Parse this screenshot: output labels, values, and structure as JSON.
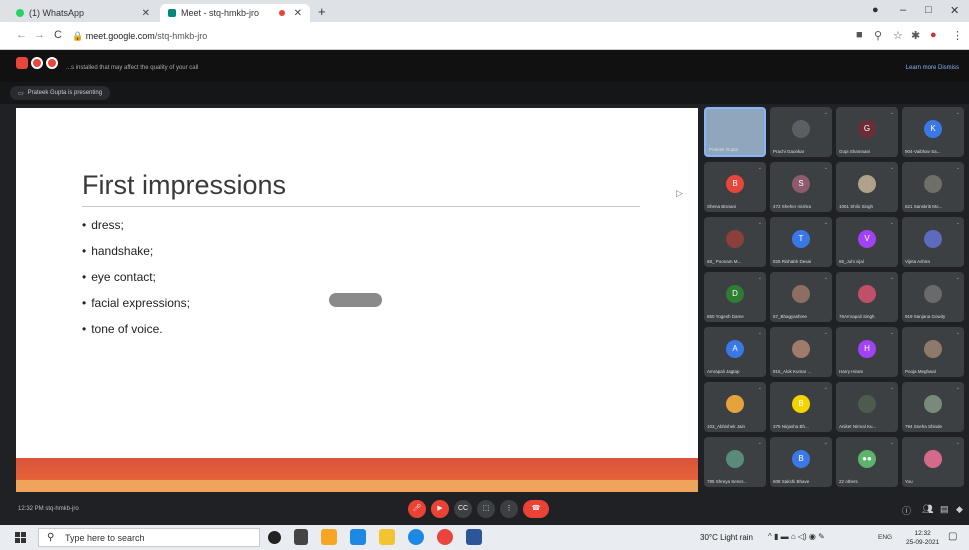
{
  "browser": {
    "tabs": [
      {
        "title": "(1) WhatsApp",
        "close": "✕"
      },
      {
        "title": "Meet - stq-hmkb-jro",
        "close": "✕"
      }
    ],
    "new_tab": "+",
    "url_host": "meet.google.com",
    "url_path": "/stq-hmkb-jro"
  },
  "meet": {
    "warning": "...s installed that may affect the quality of your call",
    "warning_actions": "Learn more   Dismiss",
    "presenting": "Prateek Gupta is presenting",
    "meeting_info": "12:32 PM   stq-hmkb-jro"
  },
  "slide": {
    "title": "First impressions",
    "bullets": [
      "dress;",
      "handshake;",
      "eye contact;",
      "facial expressions;",
      "tone of voice."
    ]
  },
  "participants": [
    {
      "name": "Prateek Gupta",
      "initial": "",
      "color": "#8fa7bd",
      "self": true
    },
    {
      "name": "Prachi Gaonkar",
      "initial": "",
      "color": "#5b5e63"
    },
    {
      "name": "Gopi Shamnani",
      "initial": "G",
      "color": "#6b2e39"
    },
    {
      "name": "904-Vaibhav Sa...",
      "initial": "K",
      "color": "#3b78e7"
    },
    {
      "name": "Shena Bisnani",
      "initial": "B",
      "color": "#e8453c"
    },
    {
      "name": "472 Sheher mishra",
      "initial": "S",
      "color": "#8d5a6e"
    },
    {
      "name": "1061 Shilo Singh",
      "initial": "",
      "color": "#b0a18a"
    },
    {
      "name": "621 Sanskriti Mo...",
      "initial": "",
      "color": "#6e6f66"
    },
    {
      "name": "68_ Poonam M...",
      "initial": "",
      "color": "#8a3f3a"
    },
    {
      "name": "825 Rishabh Desai",
      "initial": "T",
      "color": "#3b78e7"
    },
    {
      "name": "66_Juhi vijal",
      "initial": "V",
      "color": "#a142f4"
    },
    {
      "name": "Vijeta Ashira",
      "initial": "",
      "color": "#5c6bc0"
    },
    {
      "name": "650 Yogesh Dame",
      "initial": "D",
      "color": "#2e7d32"
    },
    {
      "name": "67_Bhagyashree",
      "initial": "",
      "color": "#8d6e63"
    },
    {
      "name": "76Amrapali Singh",
      "initial": "",
      "color": "#c0506a"
    },
    {
      "name": "919 Sanjana Gowity",
      "initial": "",
      "color": "#6a6a6a"
    },
    {
      "name": "Amrapali Jagtap",
      "initial": "A",
      "color": "#3b78e7"
    },
    {
      "name": "815_Alok Kumar ...",
      "initial": "",
      "color": "#9e7b6a"
    },
    {
      "name": "Harry Hiram",
      "initial": "H",
      "color": "#a142f4"
    },
    {
      "name": "Pooja Meghwal",
      "initial": "",
      "color": "#8d7a6a"
    },
    {
      "name": "103_Abhishek Jain",
      "initial": "",
      "color": "#e6a23c"
    },
    {
      "name": "375 Nirjasha Bh...",
      "initial": "B",
      "color": "#f4d400"
    },
    {
      "name": "Aniket Nirmal Ku...",
      "initial": "",
      "color": "#4e5a4e"
    },
    {
      "name": "794 Sneha Shinde",
      "initial": "",
      "color": "#7a8a7a"
    },
    {
      "name": "785 Shreya Sener...",
      "initial": "",
      "color": "#5a8a7a"
    },
    {
      "name": "608 Sakshi Bhave",
      "initial": "B",
      "color": "#3b78e7"
    },
    {
      "name": "22 others",
      "initial": "●●",
      "color": "#5bb46a"
    },
    {
      "name": "You",
      "initial": "",
      "color": "#d46a8a"
    }
  ],
  "taskbar": {
    "search_placeholder": "Type here to search",
    "weather": "30°C  Light rain",
    "lang": "ENG",
    "time": "12:32",
    "date": "25-09-2021"
  }
}
